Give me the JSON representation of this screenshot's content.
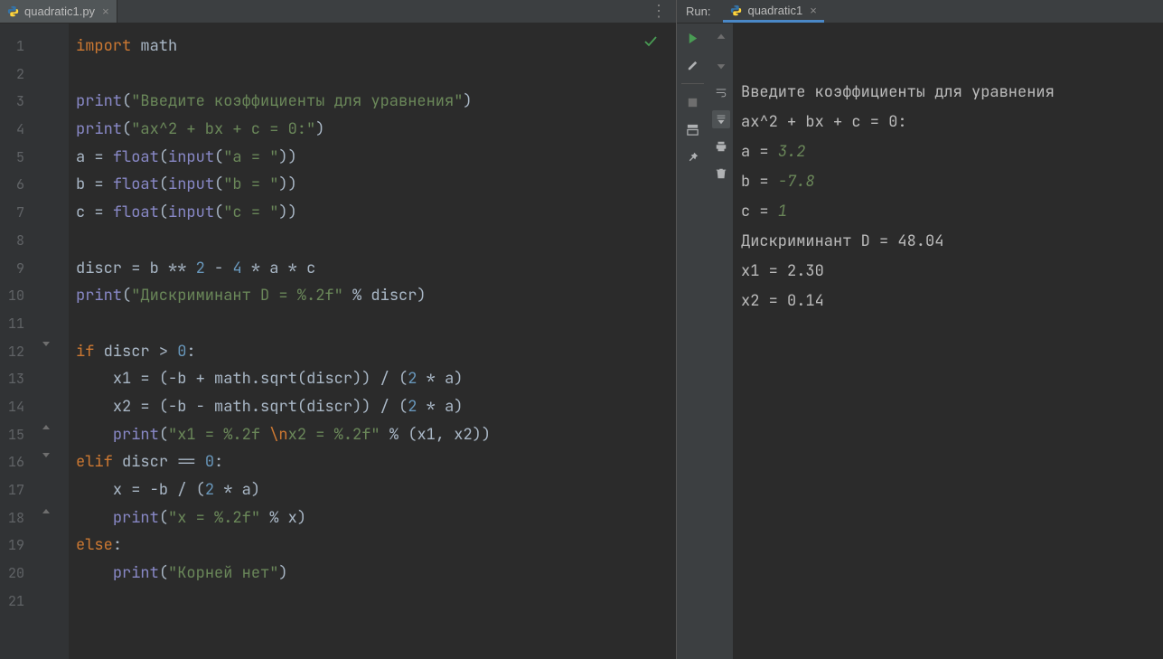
{
  "editor_tab": {
    "filename": "quadratic1.py"
  },
  "line_count": 21,
  "code": {
    "l1": {
      "kw": "import",
      "mod": "math"
    },
    "l3": {
      "fn": "print",
      "str": "\"Введите коэффициенты для уравнения\""
    },
    "l4": {
      "fn": "print",
      "str": "\"ax^2 + bx + c = 0:\""
    },
    "l5": {
      "var": "a",
      "fn1": "float",
      "fn2": "input",
      "str": "\"a = \""
    },
    "l6": {
      "var": "b",
      "fn1": "float",
      "fn2": "input",
      "str": "\"b = \""
    },
    "l7": {
      "var": "c",
      "fn1": "float",
      "fn2": "input",
      "str": "\"c = \""
    },
    "l9": {
      "var": "discr",
      "b": "b",
      "exp": "2",
      "four": "4",
      "a": "a",
      "c": "c"
    },
    "l10": {
      "fn": "print",
      "str": "\"Дискриминант D = %.2f\"",
      "arg": "discr"
    },
    "l12": {
      "kw": "if",
      "lhs": "discr",
      "op": ">",
      "rhs": "0"
    },
    "l13": {
      "var": "x1",
      "b": "b",
      "mod": "math",
      "fn": "sqrt",
      "arg": "discr",
      "two": "2",
      "a": "a"
    },
    "l14": {
      "var": "x2",
      "b": "b",
      "mod": "math",
      "fn": "sqrt",
      "arg": "discr",
      "two": "2",
      "a": "a"
    },
    "l15": {
      "fn": "print",
      "s1": "\"x1 = %.2f ",
      "esc": "\\n",
      "s2": "x2 = %.2f\"",
      "a1": "x1",
      "a2": "x2"
    },
    "l16": {
      "kw": "elif",
      "lhs": "discr",
      "op": "==",
      "rhs": "0"
    },
    "l17": {
      "var": "x",
      "b": "b",
      "two": "2",
      "a": "a"
    },
    "l18": {
      "fn": "print",
      "str": "\"x = %.2f\"",
      "arg": "x"
    },
    "l19": {
      "kw": "else"
    },
    "l20": {
      "fn": "print",
      "str": "\"Корней нет\""
    }
  },
  "run": {
    "label": "Run:",
    "tab": "quadratic1",
    "output": {
      "l1": "Введите коэффициенты для уравнения",
      "l2": "ax^2 + bx + c = 0:",
      "l3_pre": "a = ",
      "l3_in": "3.2",
      "l4_pre": "b = ",
      "l4_in": "-7.8",
      "l5_pre": "c = ",
      "l5_in": "1",
      "l6": "Дискриминант D = 48.04",
      "l7": "x1 = 2.30",
      "l8": "x2 = 0.14"
    }
  }
}
